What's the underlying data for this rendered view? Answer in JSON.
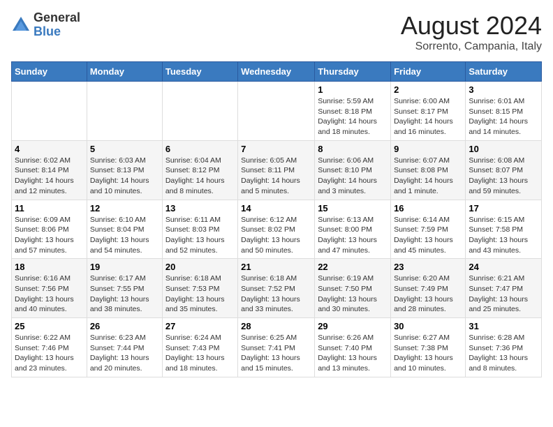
{
  "header": {
    "logo_general": "General",
    "logo_blue": "Blue",
    "main_title": "August 2024",
    "subtitle": "Sorrento, Campania, Italy"
  },
  "weekdays": [
    "Sunday",
    "Monday",
    "Tuesday",
    "Wednesday",
    "Thursday",
    "Friday",
    "Saturday"
  ],
  "weeks": [
    [
      {
        "day": "",
        "info": ""
      },
      {
        "day": "",
        "info": ""
      },
      {
        "day": "",
        "info": ""
      },
      {
        "day": "",
        "info": ""
      },
      {
        "day": "1",
        "info": "Sunrise: 5:59 AM\nSunset: 8:18 PM\nDaylight: 14 hours\nand 18 minutes."
      },
      {
        "day": "2",
        "info": "Sunrise: 6:00 AM\nSunset: 8:17 PM\nDaylight: 14 hours\nand 16 minutes."
      },
      {
        "day": "3",
        "info": "Sunrise: 6:01 AM\nSunset: 8:15 PM\nDaylight: 14 hours\nand 14 minutes."
      }
    ],
    [
      {
        "day": "4",
        "info": "Sunrise: 6:02 AM\nSunset: 8:14 PM\nDaylight: 14 hours\nand 12 minutes."
      },
      {
        "day": "5",
        "info": "Sunrise: 6:03 AM\nSunset: 8:13 PM\nDaylight: 14 hours\nand 10 minutes."
      },
      {
        "day": "6",
        "info": "Sunrise: 6:04 AM\nSunset: 8:12 PM\nDaylight: 14 hours\nand 8 minutes."
      },
      {
        "day": "7",
        "info": "Sunrise: 6:05 AM\nSunset: 8:11 PM\nDaylight: 14 hours\nand 5 minutes."
      },
      {
        "day": "8",
        "info": "Sunrise: 6:06 AM\nSunset: 8:10 PM\nDaylight: 14 hours\nand 3 minutes."
      },
      {
        "day": "9",
        "info": "Sunrise: 6:07 AM\nSunset: 8:08 PM\nDaylight: 14 hours\nand 1 minute."
      },
      {
        "day": "10",
        "info": "Sunrise: 6:08 AM\nSunset: 8:07 PM\nDaylight: 13 hours\nand 59 minutes."
      }
    ],
    [
      {
        "day": "11",
        "info": "Sunrise: 6:09 AM\nSunset: 8:06 PM\nDaylight: 13 hours\nand 57 minutes."
      },
      {
        "day": "12",
        "info": "Sunrise: 6:10 AM\nSunset: 8:04 PM\nDaylight: 13 hours\nand 54 minutes."
      },
      {
        "day": "13",
        "info": "Sunrise: 6:11 AM\nSunset: 8:03 PM\nDaylight: 13 hours\nand 52 minutes."
      },
      {
        "day": "14",
        "info": "Sunrise: 6:12 AM\nSunset: 8:02 PM\nDaylight: 13 hours\nand 50 minutes."
      },
      {
        "day": "15",
        "info": "Sunrise: 6:13 AM\nSunset: 8:00 PM\nDaylight: 13 hours\nand 47 minutes."
      },
      {
        "day": "16",
        "info": "Sunrise: 6:14 AM\nSunset: 7:59 PM\nDaylight: 13 hours\nand 45 minutes."
      },
      {
        "day": "17",
        "info": "Sunrise: 6:15 AM\nSunset: 7:58 PM\nDaylight: 13 hours\nand 43 minutes."
      }
    ],
    [
      {
        "day": "18",
        "info": "Sunrise: 6:16 AM\nSunset: 7:56 PM\nDaylight: 13 hours\nand 40 minutes."
      },
      {
        "day": "19",
        "info": "Sunrise: 6:17 AM\nSunset: 7:55 PM\nDaylight: 13 hours\nand 38 minutes."
      },
      {
        "day": "20",
        "info": "Sunrise: 6:18 AM\nSunset: 7:53 PM\nDaylight: 13 hours\nand 35 minutes."
      },
      {
        "day": "21",
        "info": "Sunrise: 6:18 AM\nSunset: 7:52 PM\nDaylight: 13 hours\nand 33 minutes."
      },
      {
        "day": "22",
        "info": "Sunrise: 6:19 AM\nSunset: 7:50 PM\nDaylight: 13 hours\nand 30 minutes."
      },
      {
        "day": "23",
        "info": "Sunrise: 6:20 AM\nSunset: 7:49 PM\nDaylight: 13 hours\nand 28 minutes."
      },
      {
        "day": "24",
        "info": "Sunrise: 6:21 AM\nSunset: 7:47 PM\nDaylight: 13 hours\nand 25 minutes."
      }
    ],
    [
      {
        "day": "25",
        "info": "Sunrise: 6:22 AM\nSunset: 7:46 PM\nDaylight: 13 hours\nand 23 minutes."
      },
      {
        "day": "26",
        "info": "Sunrise: 6:23 AM\nSunset: 7:44 PM\nDaylight: 13 hours\nand 20 minutes."
      },
      {
        "day": "27",
        "info": "Sunrise: 6:24 AM\nSunset: 7:43 PM\nDaylight: 13 hours\nand 18 minutes."
      },
      {
        "day": "28",
        "info": "Sunrise: 6:25 AM\nSunset: 7:41 PM\nDaylight: 13 hours\nand 15 minutes."
      },
      {
        "day": "29",
        "info": "Sunrise: 6:26 AM\nSunset: 7:40 PM\nDaylight: 13 hours\nand 13 minutes."
      },
      {
        "day": "30",
        "info": "Sunrise: 6:27 AM\nSunset: 7:38 PM\nDaylight: 13 hours\nand 10 minutes."
      },
      {
        "day": "31",
        "info": "Sunrise: 6:28 AM\nSunset: 7:36 PM\nDaylight: 13 hours\nand 8 minutes."
      }
    ]
  ]
}
